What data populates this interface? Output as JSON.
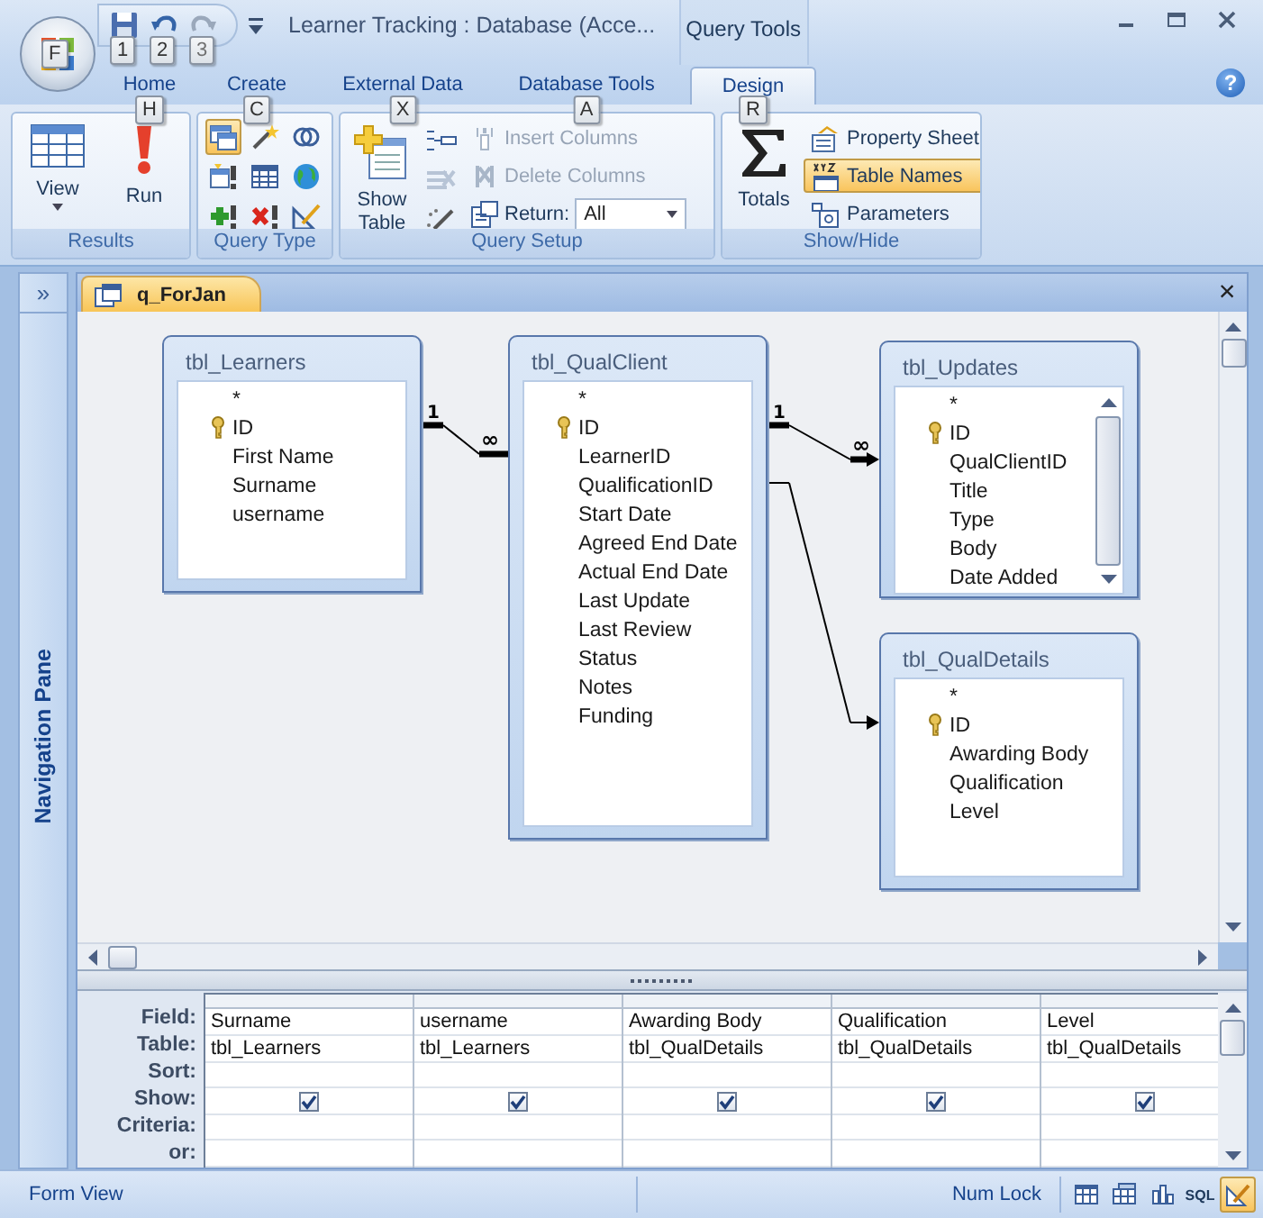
{
  "window": {
    "title": "Learner Tracking : Database (Acce...",
    "contextual_tab": "Query Tools",
    "help": "?"
  },
  "office_button": {
    "keytip": "F"
  },
  "quick_access": [
    {
      "kind": "save",
      "keytip": "1",
      "disabled": false
    },
    {
      "kind": "undo",
      "keytip": "2",
      "disabled": false
    },
    {
      "kind": "redo",
      "keytip": "3",
      "disabled": true
    }
  ],
  "tabs": [
    {
      "label": "Home",
      "keytip": "H",
      "selected": false
    },
    {
      "label": "Create",
      "keytip": "C",
      "selected": false
    },
    {
      "label": "External Data",
      "keytip": "X",
      "selected": false
    },
    {
      "label": "Database Tools",
      "keytip": "A",
      "selected": false
    },
    {
      "label": "Design",
      "keytip": "R",
      "selected": true
    }
  ],
  "ribbon": {
    "results": {
      "label": "Results",
      "view": "View",
      "run": "Run"
    },
    "query_type": {
      "label": "Query Type",
      "items": [
        {
          "kind": "select",
          "selected": true
        },
        {
          "kind": "make_table",
          "selected": false
        },
        {
          "kind": "union",
          "selected": false
        },
        {
          "kind": "append",
          "selected": false
        },
        {
          "kind": "crosstab",
          "selected": false
        },
        {
          "kind": "pass_through",
          "selected": false
        },
        {
          "kind": "update",
          "selected": false
        },
        {
          "kind": "delete",
          "selected": false
        },
        {
          "kind": "data_definition",
          "selected": false
        }
      ]
    },
    "query_setup": {
      "label": "Query Setup",
      "show_table": "Show Table",
      "commands": [
        {
          "label": "Insert Columns",
          "disabled": true
        },
        {
          "label": "Delete Columns",
          "disabled": true
        }
      ],
      "return_label": "Return:",
      "return_value": "All"
    },
    "show_hide": {
      "label": "Show/Hide",
      "totals": "Totals",
      "items": [
        {
          "kind": "property_sheet",
          "label": "Property Sheet",
          "selected": false
        },
        {
          "kind": "table_names",
          "label": "Table Names",
          "selected": true
        },
        {
          "kind": "parameters",
          "label": "Parameters",
          "selected": false
        }
      ]
    }
  },
  "navigation_pane": {
    "label": "Navigation Pane",
    "toggle": "»"
  },
  "document": {
    "tab": "q_ForJan",
    "close": "×"
  },
  "tables": [
    {
      "name": "tbl_Learners",
      "scrollbar": false,
      "fields": [
        {
          "name": "*",
          "key": false
        },
        {
          "name": "ID",
          "key": true
        },
        {
          "name": "First Name",
          "key": false
        },
        {
          "name": "Surname",
          "key": false
        },
        {
          "name": "username",
          "key": false
        }
      ]
    },
    {
      "name": "tbl_QualClient",
      "scrollbar": false,
      "fields": [
        {
          "name": "*",
          "key": false
        },
        {
          "name": "ID",
          "key": true
        },
        {
          "name": "LearnerID",
          "key": false
        },
        {
          "name": "QualificationID",
          "key": false
        },
        {
          "name": "Start Date",
          "key": false
        },
        {
          "name": "Agreed End Date",
          "key": false
        },
        {
          "name": "Actual End Date",
          "key": false
        },
        {
          "name": "Last Update",
          "key": false
        },
        {
          "name": "Last Review",
          "key": false
        },
        {
          "name": "Status",
          "key": false
        },
        {
          "name": "Notes",
          "key": false
        },
        {
          "name": "Funding",
          "key": false
        }
      ]
    },
    {
      "name": "tbl_Updates",
      "scrollbar": true,
      "fields": [
        {
          "name": "*",
          "key": false
        },
        {
          "name": "ID",
          "key": true
        },
        {
          "name": "QualClientID",
          "key": false
        },
        {
          "name": "Title",
          "key": false
        },
        {
          "name": "Type",
          "key": false
        },
        {
          "name": "Body",
          "key": false
        },
        {
          "name": "Date Added",
          "key": false
        }
      ]
    },
    {
      "name": "tbl_QualDetails",
      "scrollbar": false,
      "fields": [
        {
          "name": "*",
          "key": false
        },
        {
          "name": "ID",
          "key": true
        },
        {
          "name": "Awarding Body",
          "key": false
        },
        {
          "name": "Qualification",
          "key": false
        },
        {
          "name": "Level",
          "key": false
        }
      ]
    }
  ],
  "joins": [
    {
      "enforced": true,
      "one_label": "1",
      "many_label": "∞",
      "arrow": false
    },
    {
      "enforced": true,
      "one_label": "1",
      "many_label": "∞",
      "arrow": true
    },
    {
      "enforced": false,
      "arrow": true
    }
  ],
  "grid": {
    "row_labels": [
      "Field:",
      "Table:",
      "Sort:",
      "Show:",
      "Criteria:",
      "or:"
    ],
    "columns": [
      {
        "field": "Surname",
        "table": "tbl_Learners",
        "show": true
      },
      {
        "field": "username",
        "table": "tbl_Learners",
        "show": true
      },
      {
        "field": "Awarding Body",
        "table": "tbl_QualDetails",
        "show": true
      },
      {
        "field": "Qualification",
        "table": "tbl_QualDetails",
        "show": true
      },
      {
        "field": "Level",
        "table": "tbl_QualDetails",
        "show": true
      }
    ]
  },
  "status_bar": {
    "left": "Form View",
    "right": "Num Lock",
    "views": [
      {
        "kind": "datasheet",
        "selected": false
      },
      {
        "kind": "pivot_table",
        "selected": false
      },
      {
        "kind": "pivot_chart",
        "selected": false
      },
      {
        "kind": "sql",
        "label": "SQL",
        "selected": false
      },
      {
        "kind": "design",
        "selected": true
      }
    ]
  }
}
